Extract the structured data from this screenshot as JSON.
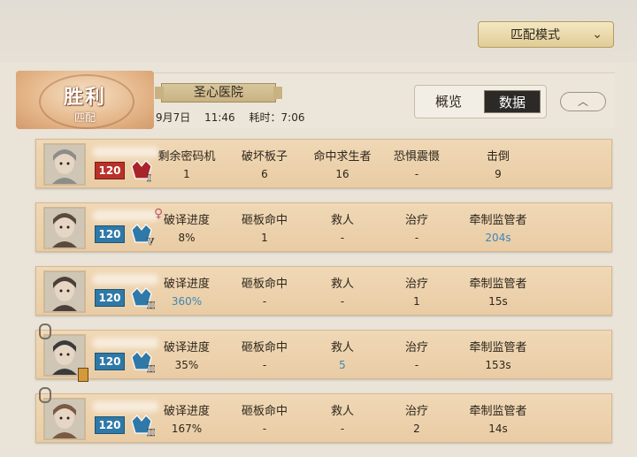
{
  "mode_button": {
    "label": "匹配模式"
  },
  "result": {
    "title": "胜利",
    "subtitle": "匹配"
  },
  "map": {
    "name": "圣心医院"
  },
  "match_meta": {
    "date": "9月7日",
    "time": "11:46",
    "duration": "耗时：7:06"
  },
  "tabs": [
    {
      "label": "概览"
    },
    {
      "label": "数据"
    }
  ],
  "active_tab": "数据",
  "colors": {
    "highlight_value": "#3d86b8",
    "hunter_level": "#b9322a",
    "survivor_level": "#2f79a8"
  },
  "players": [
    {
      "role": "hunter",
      "level": "120",
      "rank_tier": "I",
      "stats": [
        {
          "label": "剩余密码机",
          "value": "1",
          "highlight": false
        },
        {
          "label": "破坏板子",
          "value": "6",
          "highlight": false
        },
        {
          "label": "命中求生者",
          "value": "16",
          "highlight": false
        },
        {
          "label": "恐惧震慑",
          "value": "-",
          "highlight": false
        },
        {
          "label": "击倒",
          "value": "9",
          "highlight": false
        }
      ]
    },
    {
      "role": "survivor",
      "level": "120",
      "rank_tier": "V",
      "stats": [
        {
          "label": "破译进度",
          "value": "8%",
          "highlight": false
        },
        {
          "label": "砸板命中",
          "value": "1",
          "highlight": false
        },
        {
          "label": "救人",
          "value": "-",
          "highlight": false
        },
        {
          "label": "治疗",
          "value": "-",
          "highlight": false
        },
        {
          "label": "牵制监管者",
          "value": "204s",
          "highlight": true
        }
      ]
    },
    {
      "role": "survivor",
      "level": "120",
      "rank_tier": "III",
      "stats": [
        {
          "label": "破译进度",
          "value": "360%",
          "highlight": true
        },
        {
          "label": "砸板命中",
          "value": "-",
          "highlight": false
        },
        {
          "label": "救人",
          "value": "-",
          "highlight": false
        },
        {
          "label": "治疗",
          "value": "1",
          "highlight": false
        },
        {
          "label": "牵制监管者",
          "value": "15s",
          "highlight": false
        }
      ]
    },
    {
      "role": "survivor",
      "level": "120",
      "rank_tier": "III",
      "stats": [
        {
          "label": "破译进度",
          "value": "35%",
          "highlight": false
        },
        {
          "label": "砸板命中",
          "value": "-",
          "highlight": false
        },
        {
          "label": "救人",
          "value": "5",
          "highlight": true
        },
        {
          "label": "治疗",
          "value": "-",
          "highlight": false
        },
        {
          "label": "牵制监管者",
          "value": "153s",
          "highlight": false
        }
      ]
    },
    {
      "role": "survivor",
      "level": "120",
      "rank_tier": "III",
      "stats": [
        {
          "label": "破译进度",
          "value": "167%",
          "highlight": false
        },
        {
          "label": "砸板命中",
          "value": "-",
          "highlight": false
        },
        {
          "label": "救人",
          "value": "-",
          "highlight": false
        },
        {
          "label": "治疗",
          "value": "2",
          "highlight": false
        },
        {
          "label": "牵制监管者",
          "value": "14s",
          "highlight": false
        }
      ]
    }
  ]
}
